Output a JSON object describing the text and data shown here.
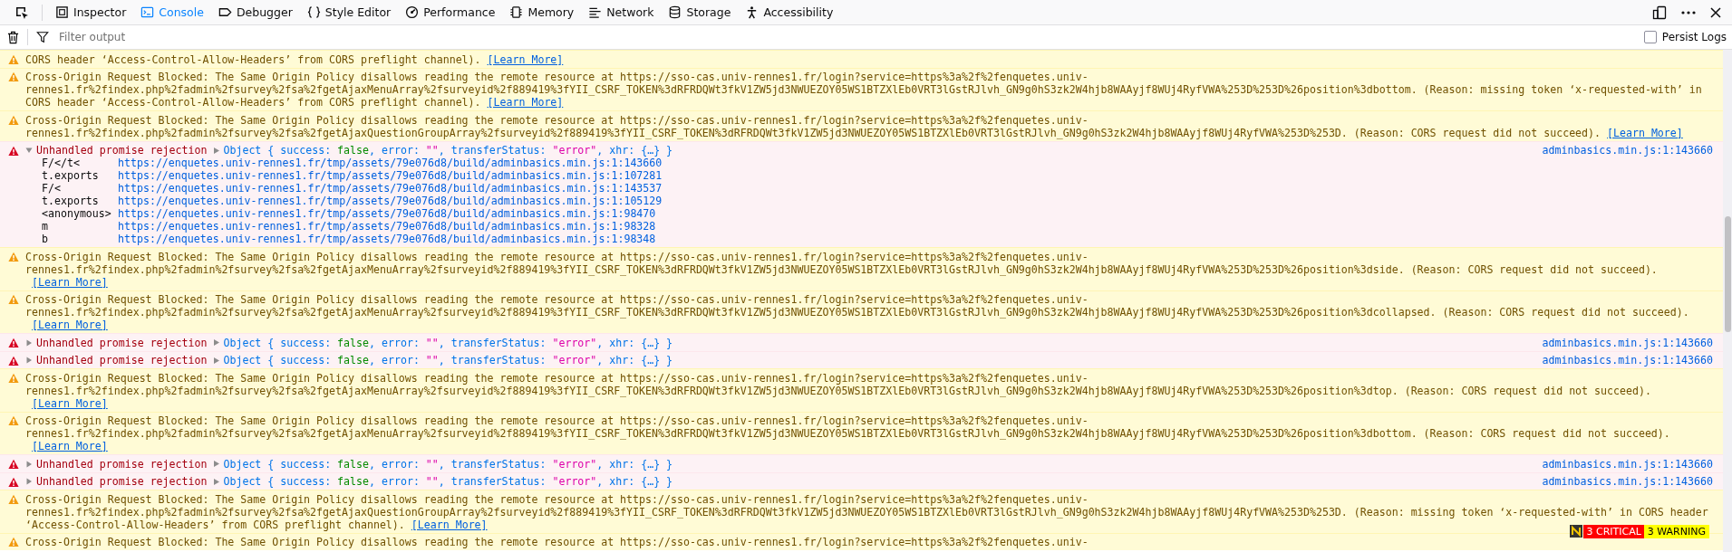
{
  "toolbar": {
    "tabs": [
      {
        "label": "Inspector",
        "selected": false
      },
      {
        "label": "Console",
        "selected": true
      },
      {
        "label": "Debugger",
        "selected": false
      },
      {
        "label": "Style Editor",
        "selected": false
      },
      {
        "label": "Performance",
        "selected": false
      },
      {
        "label": "Memory",
        "selected": false
      },
      {
        "label": "Network",
        "selected": false
      },
      {
        "label": "Storage",
        "selected": false
      },
      {
        "label": "Accessibility",
        "selected": false
      }
    ]
  },
  "filter": {
    "placeholder": "Filter output",
    "persist_logs": {
      "label": "Persist Logs",
      "checked": false
    }
  },
  "messages": [
    {
      "kind": "warning",
      "lines": [
        "CORS header ‘Access-Control-Allow-Headers’ from CORS preflight channel)."
      ],
      "link": "[Learn More]"
    },
    {
      "kind": "warning",
      "lines": [
        "Cross-Origin Request Blocked: The Same Origin Policy disallows reading the remote resource at https://sso-cas.univ-rennes1.fr/login?service=https%3a%2f%2fenquetes.univ-",
        "rennes1.fr%2findex.php%2fadmin%2fsurvey%2fsa%2fgetAjaxMenuArray%2fsurveyid%2f889419%3fYII_CSRF_TOKEN%3dRFRDQWt3fkV1ZW5jd3NWUEZOY05WS1BTZXlEb0VRT3lGstRJlvh_GN9g0hS3zk2W4hjb8WAAyjf8WUj4RyfVWA%253D%253D%26position%3dbottom. (Reason: missing token ‘x-requested-with’ in",
        "CORS header ‘Access-Control-Allow-Headers’ from CORS preflight channel)."
      ],
      "link": "[Learn More]"
    },
    {
      "kind": "warning",
      "lines": [
        "Cross-Origin Request Blocked: The Same Origin Policy disallows reading the remote resource at https://sso-cas.univ-rennes1.fr/login?service=https%3a%2f%2fenquetes.univ-",
        "rennes1.fr%2findex.php%2fadmin%2fsurvey%2fsa%2fgetAjaxQuestionGroupArray%2fsurveyid%2f889419%3fYII_CSRF_TOKEN%3dRFRDQWt3fkV1ZW5jd3NWUEZOY05WS1BTZXlEb0VRT3lGstRJlvh_GN9g0hS3zk2W4hjb8WAAyjf8WUj4RyfVWA%253D%253D. (Reason: CORS request did not succeed)."
      ],
      "link": "[Learn More]"
    },
    {
      "kind": "error",
      "title": "Unhandled promise rejection",
      "expanded": true,
      "source": "adminbasics.min.js:1:143660",
      "preview": [
        {
          "text": "Object { success: ",
          "kind": "plain"
        },
        {
          "text": "false",
          "kind": "bool"
        },
        {
          "text": ", error: ",
          "kind": "plain"
        },
        {
          "text": "\"\"",
          "kind": "string"
        },
        {
          "text": ", transferStatus: ",
          "kind": "plain"
        },
        {
          "text": "\"error\"",
          "kind": "string"
        },
        {
          "text": ", xhr: {…} }",
          "kind": "plain"
        }
      ],
      "stack": [
        {
          "fn": "F/</t<",
          "url": "https://enquetes.univ-rennes1.fr/tmp/assets/79e076d8/build/adminbasics.min.js:1:143660"
        },
        {
          "fn": "t.exports",
          "url": "https://enquetes.univ-rennes1.fr/tmp/assets/79e076d8/build/adminbasics.min.js:1:107281"
        },
        {
          "fn": "F/<",
          "url": "https://enquetes.univ-rennes1.fr/tmp/assets/79e076d8/build/adminbasics.min.js:1:143537"
        },
        {
          "fn": "t.exports",
          "url": "https://enquetes.univ-rennes1.fr/tmp/assets/79e076d8/build/adminbasics.min.js:1:105129"
        },
        {
          "fn": "<anonymous>",
          "url": "https://enquetes.univ-rennes1.fr/tmp/assets/79e076d8/build/adminbasics.min.js:1:98470"
        },
        {
          "fn": "m",
          "url": "https://enquetes.univ-rennes1.fr/tmp/assets/79e076d8/build/adminbasics.min.js:1:98328"
        },
        {
          "fn": "b",
          "url": "https://enquetes.univ-rennes1.fr/tmp/assets/79e076d8/build/adminbasics.min.js:1:98348"
        }
      ]
    },
    {
      "kind": "warning",
      "lines": [
        "Cross-Origin Request Blocked: The Same Origin Policy disallows reading the remote resource at https://sso-cas.univ-rennes1.fr/login?service=https%3a%2f%2fenquetes.univ-",
        "rennes1.fr%2findex.php%2fadmin%2fsurvey%2fsa%2fgetAjaxMenuArray%2fsurveyid%2f889419%3fYII_CSRF_TOKEN%3dRFRDQWt3fkV1ZW5jd3NWUEZOY05WS1BTZXlEb0VRT3lGstRJlvh_GN9g0hS3zk2W4hjb8WAAyjf8WUj4RyfVWA%253D%253D%26position%3dside. (Reason: CORS request did not succeed)."
      ],
      "link": "[Learn More]"
    },
    {
      "kind": "warning",
      "lines": [
        "Cross-Origin Request Blocked: The Same Origin Policy disallows reading the remote resource at https://sso-cas.univ-rennes1.fr/login?service=https%3a%2f%2fenquetes.univ-",
        "rennes1.fr%2findex.php%2fadmin%2fsurvey%2fsa%2fgetAjaxMenuArray%2fsurveyid%2f889419%3fYII_CSRF_TOKEN%3dRFRDQWt3fkV1ZW5jd3NWUEZOY05WS1BTZXlEb0VRT3lGstRJlvh_GN9g0hS3zk2W4hjb8WAAyjf8WUj4RyfVWA%253D%253D%26position%3dcollapsed. (Reason: CORS request did not succeed)."
      ],
      "link": "[Learn More]"
    },
    {
      "kind": "error",
      "title": "Unhandled promise rejection",
      "expanded": false,
      "source": "adminbasics.min.js:1:143660",
      "preview": [
        {
          "text": "Object { success: ",
          "kind": "plain"
        },
        {
          "text": "false",
          "kind": "bool"
        },
        {
          "text": ", error: ",
          "kind": "plain"
        },
        {
          "text": "\"\"",
          "kind": "string"
        },
        {
          "text": ", transferStatus: ",
          "kind": "plain"
        },
        {
          "text": "\"error\"",
          "kind": "string"
        },
        {
          "text": ", xhr: {…} }",
          "kind": "plain"
        }
      ]
    },
    {
      "kind": "error",
      "title": "Unhandled promise rejection",
      "expanded": false,
      "source": "adminbasics.min.js:1:143660",
      "preview": [
        {
          "text": "Object { success: ",
          "kind": "plain"
        },
        {
          "text": "false",
          "kind": "bool"
        },
        {
          "text": ", error: ",
          "kind": "plain"
        },
        {
          "text": "\"\"",
          "kind": "string"
        },
        {
          "text": ", transferStatus: ",
          "kind": "plain"
        },
        {
          "text": "\"error\"",
          "kind": "string"
        },
        {
          "text": ", xhr: {…} }",
          "kind": "plain"
        }
      ]
    },
    {
      "kind": "warning",
      "lines": [
        "Cross-Origin Request Blocked: The Same Origin Policy disallows reading the remote resource at https://sso-cas.univ-rennes1.fr/login?service=https%3a%2f%2fenquetes.univ-",
        "rennes1.fr%2findex.php%2fadmin%2fsurvey%2fsa%2fgetAjaxMenuArray%2fsurveyid%2f889419%3fYII_CSRF_TOKEN%3dRFRDQWt3fkV1ZW5jd3NWUEZOY05WS1BTZXlEb0VRT3lGstRJlvh_GN9g0hS3zk2W4hjb8WAAyjf8WUj4RyfVWA%253D%253D%26position%3dtop. (Reason: CORS request did not succeed)."
      ],
      "link": "[Learn More]"
    },
    {
      "kind": "warning",
      "lines": [
        "Cross-Origin Request Blocked: The Same Origin Policy disallows reading the remote resource at https://sso-cas.univ-rennes1.fr/login?service=https%3a%2f%2fenquetes.univ-",
        "rennes1.fr%2findex.php%2fadmin%2fsurvey%2fsa%2fgetAjaxMenuArray%2fsurveyid%2f889419%3fYII_CSRF_TOKEN%3dRFRDQWt3fkV1ZW5jd3NWUEZOY05WS1BTZXlEb0VRT3lGstRJlvh_GN9g0hS3zk2W4hjb8WAAyjf8WUj4RyfVWA%253D%253D%26position%3dbottom. (Reason: CORS request did not succeed)."
      ],
      "link": "[Learn More]"
    },
    {
      "kind": "error",
      "title": "Unhandled promise rejection",
      "expanded": false,
      "source": "adminbasics.min.js:1:143660",
      "preview": [
        {
          "text": "Object { success: ",
          "kind": "plain"
        },
        {
          "text": "false",
          "kind": "bool"
        },
        {
          "text": ", error: ",
          "kind": "plain"
        },
        {
          "text": "\"\"",
          "kind": "string"
        },
        {
          "text": ", transferStatus: ",
          "kind": "plain"
        },
        {
          "text": "\"error\"",
          "kind": "string"
        },
        {
          "text": ", xhr: {…} }",
          "kind": "plain"
        }
      ]
    },
    {
      "kind": "error",
      "title": "Unhandled promise rejection",
      "expanded": false,
      "source": "adminbasics.min.js:1:143660",
      "preview": [
        {
          "text": "Object { success: ",
          "kind": "plain"
        },
        {
          "text": "false",
          "kind": "bool"
        },
        {
          "text": ", error: ",
          "kind": "plain"
        },
        {
          "text": "\"\"",
          "kind": "string"
        },
        {
          "text": ", transferStatus: ",
          "kind": "plain"
        },
        {
          "text": "\"error\"",
          "kind": "string"
        },
        {
          "text": ", xhr: {…} }",
          "kind": "plain"
        }
      ]
    },
    {
      "kind": "warning",
      "lines": [
        "Cross-Origin Request Blocked: The Same Origin Policy disallows reading the remote resource at https://sso-cas.univ-rennes1.fr/login?service=https%3a%2f%2fenquetes.univ-",
        "rennes1.fr%2findex.php%2fadmin%2fsurvey%2fsa%2fgetAjaxQuestionGroupArray%2fsurveyid%2f889419%3fYII_CSRF_TOKEN%3dRFRDQWt3fkV1ZW5jd3NWUEZOY05WS1BTZXlEb0VRT3lGstRJlvh_GN9g0hS3zk2W4hjb8WAAyjf8WUj4RyfVWA%253D%253D. (Reason: missing token ‘x-requested-with’ in CORS header",
        "‘Access-Control-Allow-Headers’ from CORS preflight channel)."
      ],
      "link": "[Learn More]"
    },
    {
      "kind": "warning",
      "lines": [
        "Cross-Origin Request Blocked: The Same Origin Policy disallows reading the remote resource at https://sso-cas.univ-rennes1.fr/login?service=https%3a%2f%2fenquetes.univ-"
      ]
    }
  ],
  "badge": {
    "critical": "3 CRITICAL",
    "warning": "3 WARNING"
  }
}
